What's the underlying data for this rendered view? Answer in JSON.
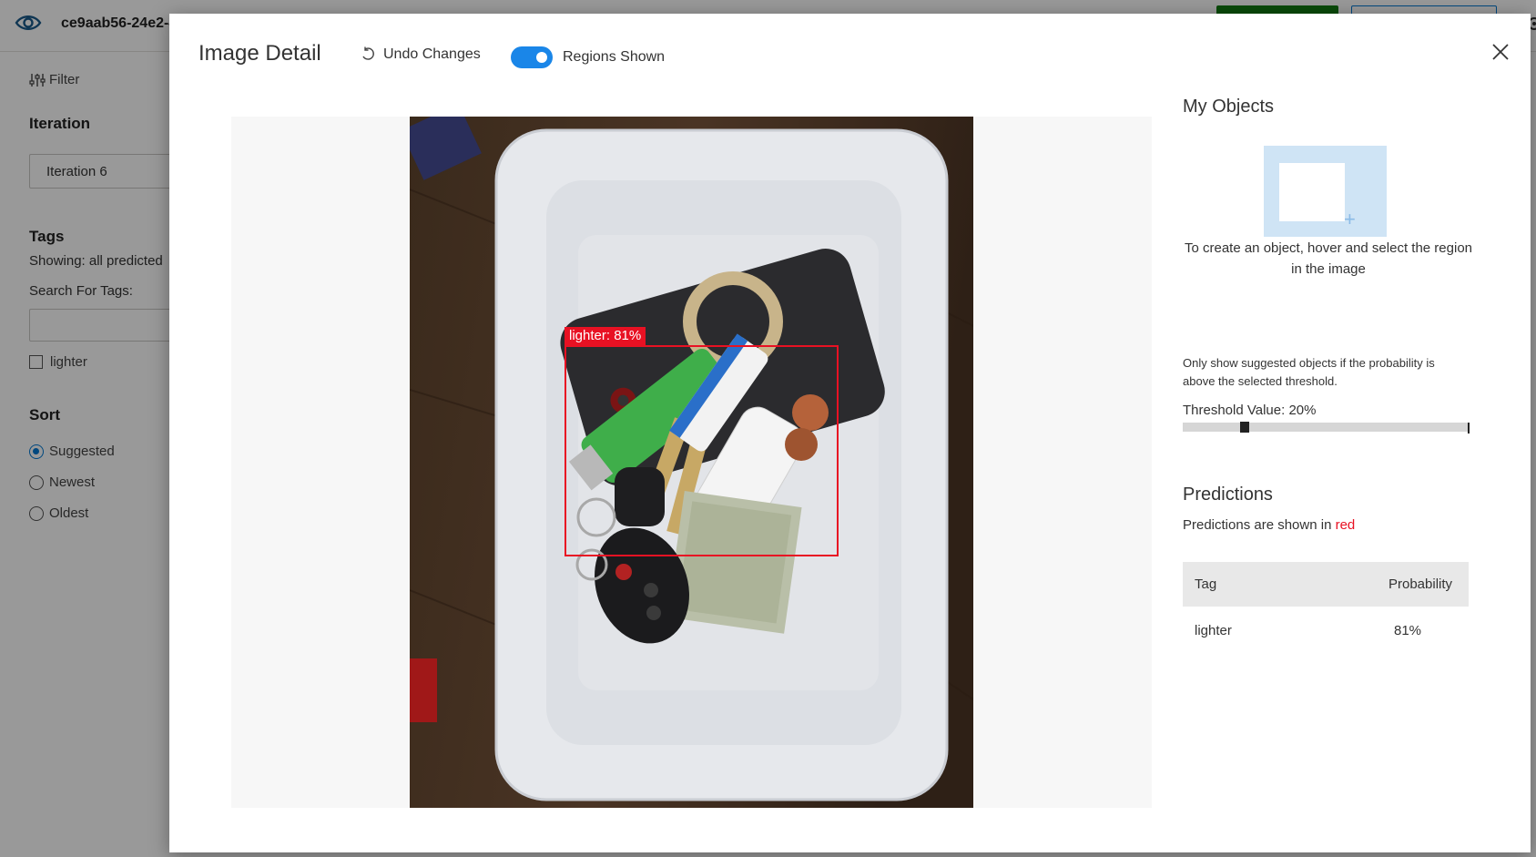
{
  "app": {
    "title": "ce9aab56-24e2-4"
  },
  "sidebar": {
    "filter_label": "Filter",
    "iteration_heading": "Iteration",
    "iteration_value": "Iteration 6",
    "tags_heading": "Tags",
    "showing_text": "Showing: all predicted",
    "search_label": "Search For Tags:",
    "search_value": "",
    "tag_checkbox_label": "lighter",
    "sort_heading": "Sort",
    "sort_options": [
      "Suggested",
      "Newest",
      "Oldest"
    ],
    "sort_selected": "Suggested"
  },
  "modal": {
    "title": "Image Detail",
    "undo_label": "Undo Changes",
    "regions_toggle_label": "Regions Shown",
    "regions_shown": true,
    "region_label": "lighter: 81%",
    "my_objects_heading": "My Objects",
    "create_hint": "To create an object, hover and select the region in the image",
    "threshold_note": "Only show suggested objects if the probability is above the selected threshold.",
    "threshold_label": "Threshold Value: 20%",
    "threshold_value": 0.2,
    "predictions_heading": "Predictions",
    "predictions_note_prefix": "Predictions are shown in ",
    "predictions_note_color_word": "red",
    "table": {
      "headers": [
        "Tag",
        "Probability"
      ],
      "rows": [
        {
          "tag": "lighter",
          "probability": "81%"
        }
      ]
    }
  },
  "colors": {
    "accent": "#1a86e8",
    "prediction_red": "#e81123"
  }
}
